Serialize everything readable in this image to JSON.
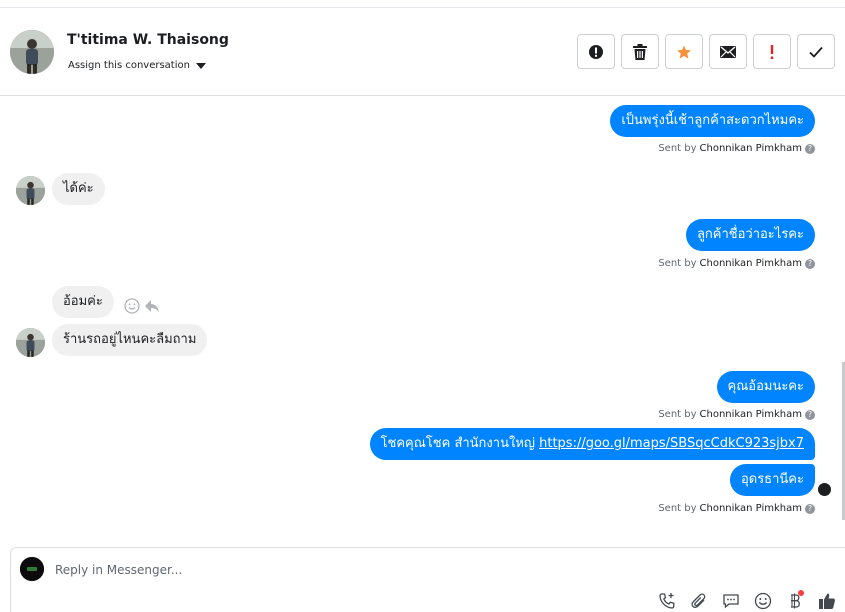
{
  "header": {
    "contact_name": "T'titima W. Thaisong",
    "assign_label": "Assign this conversation",
    "actions": [
      {
        "name": "mark-spam-button",
        "icon": "alert-circle-icon"
      },
      {
        "name": "delete-button",
        "icon": "trash-icon"
      },
      {
        "name": "star-button",
        "icon": "star-icon",
        "color": "#f7923b"
      },
      {
        "name": "mark-unread-button",
        "icon": "envelope-icon"
      },
      {
        "name": "follow-up-button",
        "icon": "exclamation-icon",
        "color": "#e02424"
      },
      {
        "name": "mark-done-button",
        "icon": "checkmark-icon"
      }
    ]
  },
  "messages": [
    {
      "direction": "outgoing",
      "text": "เป็นพรุ่งนี้เช้าลูกค้าสะดวกไหมคะ"
    },
    {
      "direction": "outgoing-meta",
      "sent_by_prefix": "Sent by",
      "sender": "Chonnikan Pimkham"
    },
    {
      "direction": "incoming",
      "text": "ได้ค่ะ"
    },
    {
      "direction": "outgoing",
      "text": "ลูกค้าชื่อว่าอะไรคะ"
    },
    {
      "direction": "outgoing-meta",
      "sent_by_prefix": "Sent by",
      "sender": "Chonnikan Pimkham"
    },
    {
      "direction": "incoming",
      "text": "อ้อมค่ะ"
    },
    {
      "direction": "incoming",
      "text": "ร้านรถอยู่ไหนคะลืมถาม"
    },
    {
      "direction": "outgoing",
      "text": "คุณอ้อมนะคะ"
    },
    {
      "direction": "outgoing-meta",
      "sent_by_prefix": "Sent by",
      "sender": "Chonnikan Pimkham"
    },
    {
      "direction": "outgoing",
      "text_prefix": "โชคคุณโชค สำนักงานใหญ่",
      "link": "https://goo.gl/maps/SBSqcCdkC923sjbx7"
    },
    {
      "direction": "outgoing",
      "text": "อุดรธานีคะ"
    },
    {
      "direction": "outgoing-meta",
      "sent_by_prefix": "Sent by",
      "sender": "Chonnikan Pimkham"
    }
  ],
  "composer": {
    "placeholder": "Reply in Messenger...",
    "tools": [
      "phone-add-icon",
      "paperclip-icon",
      "saved-replies-icon",
      "emoji-icon",
      "baht-payment-icon",
      "thumbs-up-icon"
    ]
  },
  "colors": {
    "outgoing_bubble": "#0084ff",
    "incoming_bubble": "#f1f0f0",
    "star": "#f7923b",
    "alert": "#e02424"
  }
}
